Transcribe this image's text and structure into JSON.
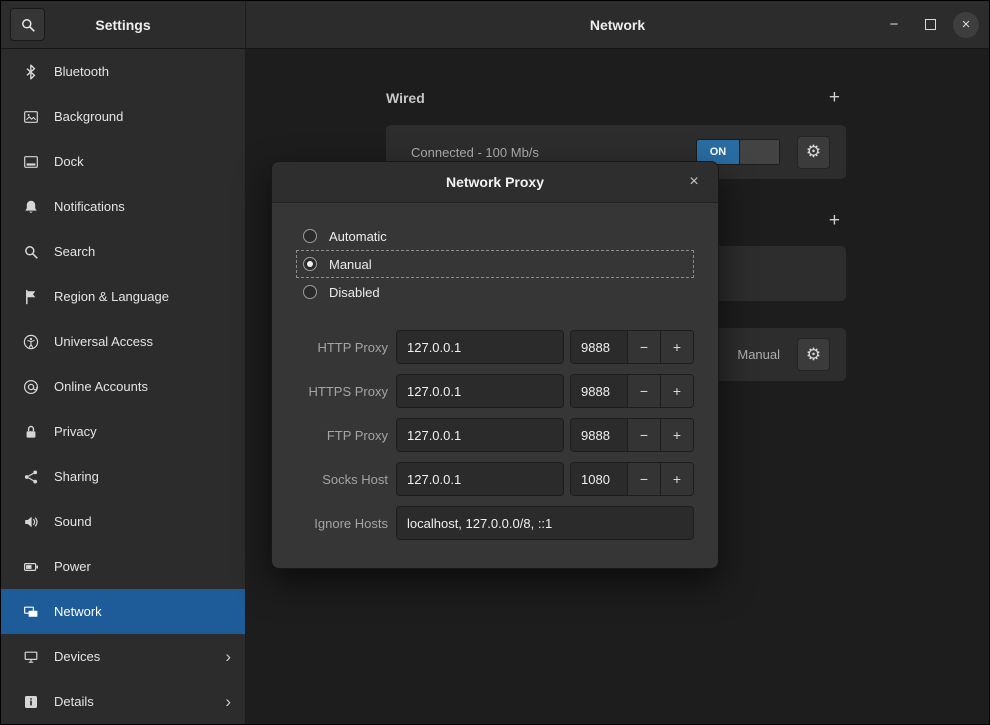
{
  "icons": {
    "gear": "⚙",
    "add": "+",
    "close": "×",
    "chevron": "›",
    "minimize": "−",
    "minus": "−",
    "plus": "+"
  },
  "titlebar": {
    "left_title": "Settings",
    "right_title": "Network"
  },
  "sidebar": {
    "items": [
      {
        "label": "Bluetooth",
        "icon": "bluetooth-icon",
        "selected": false,
        "chevron": false
      },
      {
        "label": "Background",
        "icon": "background-icon",
        "selected": false,
        "chevron": false
      },
      {
        "label": "Dock",
        "icon": "dock-icon",
        "selected": false,
        "chevron": false
      },
      {
        "label": "Notifications",
        "icon": "notifications-icon",
        "selected": false,
        "chevron": false
      },
      {
        "label": "Search",
        "icon": "search-icon",
        "selected": false,
        "chevron": false
      },
      {
        "label": "Region & Language",
        "icon": "region-language-icon",
        "selected": false,
        "chevron": false
      },
      {
        "label": "Universal Access",
        "icon": "universal-access-icon",
        "selected": false,
        "chevron": false
      },
      {
        "label": "Online Accounts",
        "icon": "online-accounts-icon",
        "selected": false,
        "chevron": false
      },
      {
        "label": "Privacy",
        "icon": "privacy-icon",
        "selected": false,
        "chevron": false
      },
      {
        "label": "Sharing",
        "icon": "sharing-icon",
        "selected": false,
        "chevron": false
      },
      {
        "label": "Sound",
        "icon": "sound-icon",
        "selected": false,
        "chevron": false
      },
      {
        "label": "Power",
        "icon": "power-icon",
        "selected": false,
        "chevron": false
      },
      {
        "label": "Network",
        "icon": "network-icon",
        "selected": true,
        "chevron": false
      },
      {
        "label": "Devices",
        "icon": "devices-icon",
        "selected": false,
        "chevron": true
      },
      {
        "label": "Details",
        "icon": "details-icon",
        "selected": false,
        "chevron": true
      }
    ]
  },
  "main": {
    "wired_title": "Wired",
    "connection_status": "Connected - 100 Mb/s",
    "switch_label": "ON",
    "proxy_mode": "Manual"
  },
  "dialog": {
    "title": "Network Proxy",
    "modes": [
      {
        "label": "Automatic",
        "selected": false
      },
      {
        "label": "Manual",
        "selected": true
      },
      {
        "label": "Disabled",
        "selected": false
      }
    ],
    "fields": [
      {
        "label": "HTTP Proxy",
        "host": "127.0.0.1",
        "port": "9888"
      },
      {
        "label": "HTTPS Proxy",
        "host": "127.0.0.1",
        "port": "9888"
      },
      {
        "label": "FTP Proxy",
        "host": "127.0.0.1",
        "port": "9888"
      },
      {
        "label": "Socks Host",
        "host": "127.0.0.1",
        "port": "1080"
      }
    ],
    "ignore_hosts": {
      "label": "Ignore Hosts",
      "value": "localhost, 127.0.0.0/8, ::1"
    }
  },
  "colors": {
    "selection_accent": "#1d5b99",
    "switch_on": "#2a6da3"
  }
}
